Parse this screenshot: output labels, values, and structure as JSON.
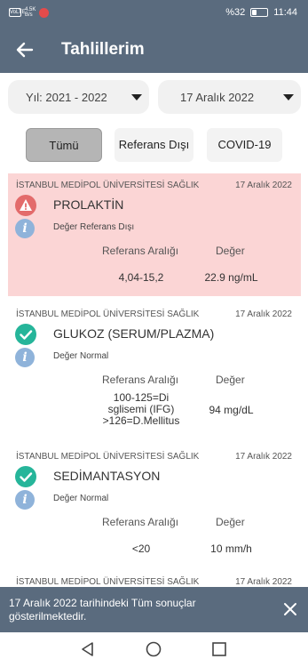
{
  "status_bar": {
    "net_label": "VoLTE",
    "speed": "4.5K",
    "speed_unit": "B/s",
    "battery": "%32",
    "battery_level": 0.32,
    "time": "11:44"
  },
  "header": {
    "title": "Tahlillerim"
  },
  "filters": {
    "year": "Yıl: 2021 - 2022",
    "date": "17 Aralık 2022"
  },
  "tabs": [
    {
      "label": "Tümü",
      "active": true
    },
    {
      "label": "Referans Dışı"
    },
    {
      "label": "COVID-19"
    }
  ],
  "columns": {
    "range": "Referans Aralığı",
    "value": "Değer"
  },
  "results": [
    {
      "hospital": "İSTANBUL MEDİPOL ÜNİVERSİTESİ SAĞLIK",
      "date": "17 Aralık 2022",
      "test": "PROLAKTİN",
      "status": "Değer Referans Dışı",
      "range": "4,04-15,2",
      "value": "22.9 ng/mL"
    },
    {
      "hospital": "İSTANBUL MEDİPOL ÜNİVERSİTESİ SAĞLIK",
      "date": "17 Aralık 2022",
      "test": "GLUKOZ (SERUM/PLAZMA)",
      "status": "Değer Normal",
      "range_lines": [
        "100-125=Di",
        "sglisemi (IFG)",
        ">126=D.Mellitus"
      ],
      "value": "94 mg/dL"
    },
    {
      "hospital": "İSTANBUL MEDİPOL ÜNİVERSİTESİ SAĞLIK",
      "date": "17 Aralık 2022",
      "test": "SEDİMANTASYON",
      "status": "Değer Normal",
      "range": "<20",
      "value": "10 mm/h"
    },
    {
      "hospital": "İSTANBUL MEDİPOL ÜNİVERSİTESİ SAĞLIK",
      "date": "17 Aralık 2022"
    }
  ],
  "snackbar": {
    "message": "17 Aralık 2022 tarihindeki Tüm sonuçlar gösterilmektedir."
  }
}
